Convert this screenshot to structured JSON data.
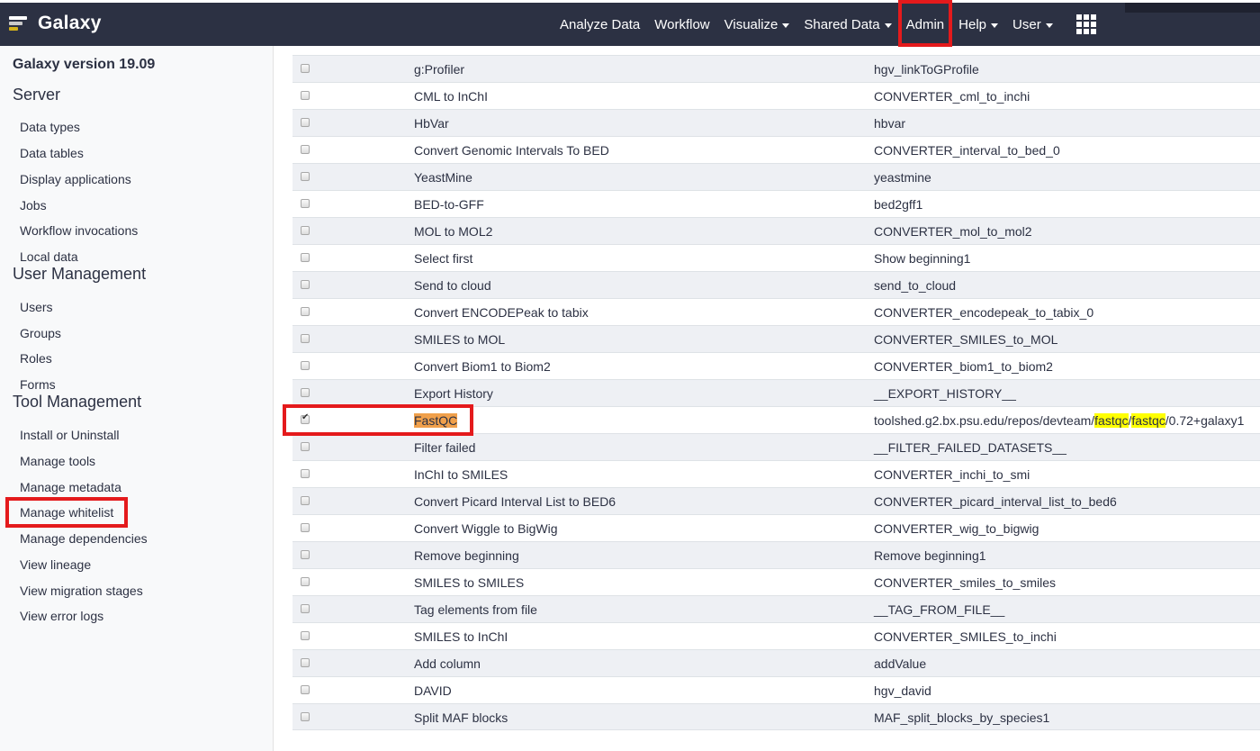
{
  "navbar": {
    "brand": "Galaxy",
    "items": [
      {
        "label": "Analyze Data",
        "caret": false
      },
      {
        "label": "Workflow",
        "caret": false
      },
      {
        "label": "Visualize",
        "caret": true
      },
      {
        "label": "Shared Data",
        "caret": true
      },
      {
        "label": "Admin",
        "caret": false
      },
      {
        "label": "Help",
        "caret": true
      },
      {
        "label": "User",
        "caret": true
      }
    ],
    "apps_icon": "grid-icon"
  },
  "sidebar": {
    "version": "Galaxy version 19.09",
    "sections": [
      {
        "title": "Server",
        "links": [
          "Data types",
          "Data tables",
          "Display applications",
          "Jobs",
          "Workflow invocations",
          "Local data"
        ]
      },
      {
        "title": "User Management",
        "links": [
          "Users",
          "Groups",
          "Roles",
          "Forms"
        ]
      },
      {
        "title": "Tool Management",
        "links": [
          "Install or Uninstall",
          "Manage tools",
          "Manage metadata",
          "Manage whitelist",
          "Manage dependencies",
          "View lineage",
          "View migration stages",
          "View error logs"
        ]
      }
    ]
  },
  "tools": [
    {
      "name": "g:Profiler",
      "id": "hgv_linkToGProfile",
      "checked": false
    },
    {
      "name": "CML to InChI",
      "id": "CONVERTER_cml_to_inchi",
      "checked": false
    },
    {
      "name": "HbVar",
      "id": "hbvar",
      "checked": false
    },
    {
      "name": "Convert Genomic Intervals To BED",
      "id": "CONVERTER_interval_to_bed_0",
      "checked": false
    },
    {
      "name": "YeastMine",
      "id": "yeastmine",
      "checked": false
    },
    {
      "name": "BED-to-GFF",
      "id": "bed2gff1",
      "checked": false
    },
    {
      "name": "MOL to MOL2",
      "id": "CONVERTER_mol_to_mol2",
      "checked": false
    },
    {
      "name": "Select first",
      "id": "Show beginning1",
      "checked": false
    },
    {
      "name": "Send to cloud",
      "id": "send_to_cloud",
      "checked": false
    },
    {
      "name": "Convert ENCODEPeak to tabix",
      "id": "CONVERTER_encodepeak_to_tabix_0",
      "checked": false
    },
    {
      "name": "SMILES to MOL",
      "id": "CONVERTER_SMILES_to_MOL",
      "checked": false
    },
    {
      "name": "Convert Biom1 to Biom2",
      "id": "CONVERTER_biom1_to_biom2",
      "checked": false
    },
    {
      "name": "Export History",
      "id": "__EXPORT_HISTORY__",
      "checked": false
    },
    {
      "name": "FastQC",
      "id": "toolshed.g2.bx.psu.edu/repos/devteam/fastqc/fastqc/0.72+galaxy1",
      "checked": true,
      "id_parts": [
        {
          "text": "toolshed.g2.bx.psu.edu/repos/devteam/",
          "hl": false
        },
        {
          "text": "fastqc",
          "hl": true
        },
        {
          "text": "/",
          "hl": false
        },
        {
          "text": "fastqc",
          "hl": true
        },
        {
          "text": "/0.72+galaxy1",
          "hl": false
        }
      ]
    },
    {
      "name": "Filter failed",
      "id": "__FILTER_FAILED_DATASETS__",
      "checked": false
    },
    {
      "name": "InChI to SMILES",
      "id": "CONVERTER_inchi_to_smi",
      "checked": false
    },
    {
      "name": "Convert Picard Interval List to BED6",
      "id": "CONVERTER_picard_interval_list_to_bed6",
      "checked": false
    },
    {
      "name": "Convert Wiggle to BigWig",
      "id": "CONVERTER_wig_to_bigwig",
      "checked": false
    },
    {
      "name": "Remove beginning",
      "id": "Remove beginning1",
      "checked": false
    },
    {
      "name": "SMILES to SMILES",
      "id": "CONVERTER_smiles_to_smiles",
      "checked": false
    },
    {
      "name": "Tag elements from file",
      "id": "__TAG_FROM_FILE__",
      "checked": false
    },
    {
      "name": "SMILES to InChI",
      "id": "CONVERTER_SMILES_to_inchi",
      "checked": false
    },
    {
      "name": "Add column",
      "id": "addValue",
      "checked": false
    },
    {
      "name": "DAVID",
      "id": "hgv_david",
      "checked": false
    },
    {
      "name": "Split MAF blocks",
      "id": "MAF_split_blocks_by_species1",
      "checked": false
    }
  ],
  "colors": {
    "navbar": "#2c3143",
    "highlight_box": "#e41a1c",
    "search_highlight": "#ffff00",
    "current_match": "#f0a04b"
  }
}
